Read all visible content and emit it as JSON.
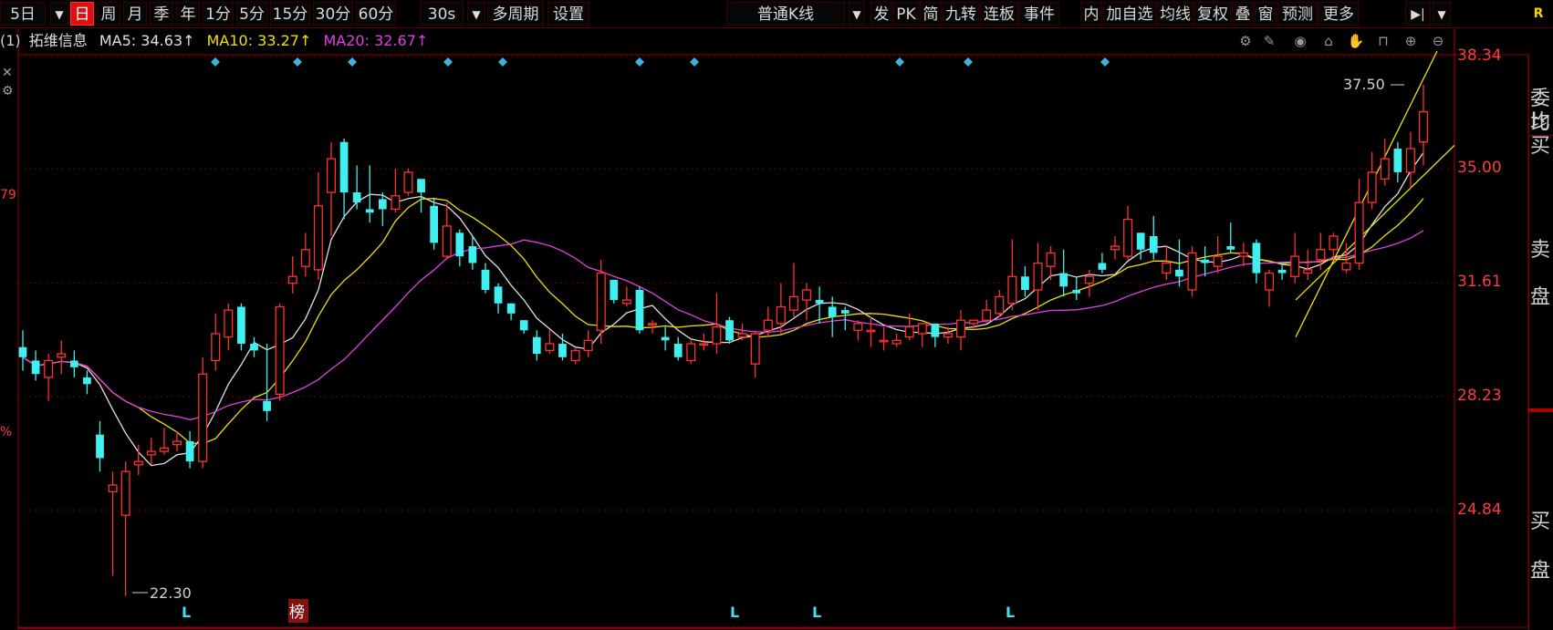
{
  "toolbar": {
    "period_dropdown": "5日",
    "periods": [
      "日",
      "周",
      "月",
      "季",
      "年",
      "1分",
      "5分",
      "15分",
      "30分",
      "60分"
    ],
    "active_period": "日",
    "interval_dropdown": "30s",
    "multi_period": "多周期",
    "settings": "设置",
    "chart_type": "普通K线",
    "right_buttons": [
      "发",
      "PK",
      "简",
      "九转",
      "连板",
      "事件",
      "内",
      "加自选",
      "均线",
      "复权",
      "叠",
      "窗",
      "预测",
      "更多"
    ],
    "r_badge": "R"
  },
  "info": {
    "prefix": "(1)",
    "name": "拓维信息",
    "ma5": "MA5: 34.63↑",
    "ma10": "MA10: 33.27↑",
    "ma20": "MA20: 32.67↑",
    "colors": {
      "name": "#e0e0e0",
      "ma5": "#e0e0e0",
      "ma10": "#f0e000",
      "ma20": "#e040e0"
    }
  },
  "price_axis": [
    "38.34",
    "35.00",
    "31.61",
    "28.23",
    "24.84"
  ],
  "annotations": {
    "high": "37.50",
    "low": "22.30"
  },
  "markers": {
    "L": "L",
    "bang": "榜"
  },
  "right_panel": [
    "委比",
    "均买",
    "卖",
    "盘",
    "买",
    "盘"
  ],
  "left_fragments": [
    "79",
    "%"
  ],
  "chart_data": {
    "type": "candlestick",
    "ylim": [
      21.5,
      39.5
    ],
    "up_color": "#ff3030",
    "down_color": "#40f0f0",
    "ma_colors": {
      "MA5": "#e0e0e0",
      "MA10": "#f0e000",
      "MA20": "#e040e0"
    },
    "candles": [
      [
        29.7,
        29.4,
        30.2,
        29.0
      ],
      [
        29.3,
        28.9,
        29.6,
        28.7
      ],
      [
        28.8,
        29.3,
        29.5,
        28.1
      ],
      [
        29.4,
        29.5,
        29.9,
        28.9
      ],
      [
        29.3,
        29.1,
        29.6,
        28.8
      ],
      [
        28.8,
        28.6,
        29.0,
        28.3
      ],
      [
        27.1,
        26.4,
        27.5,
        26.0
      ],
      [
        25.4,
        25.6,
        26.0,
        22.9
      ],
      [
        24.7,
        26.0,
        26.3,
        22.3
      ],
      [
        26.2,
        26.3,
        26.8,
        25.9
      ],
      [
        26.5,
        26.6,
        27.0,
        26.2
      ],
      [
        26.6,
        26.7,
        27.3,
        26.5
      ],
      [
        26.8,
        26.9,
        27.2,
        26.6
      ],
      [
        26.9,
        26.3,
        27.2,
        26.1
      ],
      [
        26.3,
        28.9,
        29.4,
        26.1
      ],
      [
        29.3,
        30.1,
        30.7,
        29.0
      ],
      [
        30.0,
        30.8,
        31.0,
        29.6
      ],
      [
        30.9,
        29.8,
        31.0,
        29.6
      ],
      [
        29.8,
        29.6,
        30.0,
        29.4
      ],
      [
        28.1,
        27.8,
        29.8,
        27.5
      ],
      [
        28.3,
        30.9,
        31.0,
        28.1
      ],
      [
        31.6,
        31.8,
        32.4,
        31.3
      ],
      [
        32.1,
        32.6,
        33.1,
        31.8
      ],
      [
        32.0,
        33.9,
        34.9,
        31.7
      ],
      [
        34.3,
        35.3,
        35.8,
        33.0
      ],
      [
        35.8,
        34.3,
        35.9,
        33.5
      ],
      [
        34.3,
        34.0,
        35.1,
        33.8
      ],
      [
        33.8,
        33.7,
        35.1,
        33.4
      ],
      [
        34.1,
        33.8,
        34.3,
        33.3
      ],
      [
        33.8,
        34.2,
        35.0,
        33.7
      ],
      [
        34.3,
        34.9,
        35.0,
        34.2
      ],
      [
        34.7,
        34.3,
        34.7,
        33.7
      ],
      [
        33.9,
        32.8,
        34.1,
        32.6
      ],
      [
        32.4,
        33.3,
        34.0,
        32.3
      ],
      [
        33.1,
        32.4,
        33.2,
        32.1
      ],
      [
        32.7,
        32.2,
        33.0,
        32.0
      ],
      [
        32.0,
        31.4,
        32.2,
        31.3
      ],
      [
        31.5,
        31.0,
        31.6,
        30.7
      ],
      [
        31.0,
        30.7,
        31.0,
        30.5
      ],
      [
        30.5,
        30.2,
        30.5,
        30.1
      ],
      [
        30.0,
        29.5,
        30.2,
        29.3
      ],
      [
        29.6,
        29.8,
        30.2,
        29.5
      ],
      [
        29.8,
        29.4,
        30.1,
        29.3
      ],
      [
        29.3,
        29.6,
        29.7,
        29.2
      ],
      [
        29.6,
        29.9,
        30.2,
        29.4
      ],
      [
        30.2,
        31.9,
        32.3,
        29.8
      ],
      [
        31.7,
        31.1,
        31.7,
        31.0
      ],
      [
        31.0,
        31.1,
        31.5,
        30.9
      ],
      [
        31.4,
        30.2,
        31.5,
        30.1
      ],
      [
        30.4,
        30.4,
        30.5,
        30.1
      ],
      [
        30.0,
        29.9,
        30.3,
        29.6
      ],
      [
        29.8,
        29.4,
        30.0,
        29.3
      ],
      [
        29.3,
        29.8,
        29.9,
        29.2
      ],
      [
        29.8,
        29.8,
        30.1,
        29.6
      ],
      [
        29.8,
        30.3,
        31.3,
        29.5
      ],
      [
        30.5,
        29.9,
        30.6,
        29.8
      ],
      [
        30.0,
        30.1,
        30.4,
        29.9
      ],
      [
        29.2,
        30.1,
        30.2,
        28.8
      ],
      [
        30.2,
        30.5,
        30.9,
        30.0
      ],
      [
        30.4,
        30.9,
        31.6,
        30.1
      ],
      [
        30.8,
        31.2,
        32.2,
        30.6
      ],
      [
        31.1,
        31.4,
        31.6,
        30.5
      ],
      [
        31.1,
        31.0,
        31.5,
        30.4
      ],
      [
        30.9,
        30.6,
        31.2,
        30.0
      ],
      [
        30.8,
        30.7,
        30.9,
        30.2
      ],
      [
        30.2,
        30.4,
        30.5,
        29.9
      ],
      [
        30.2,
        30.2,
        30.6,
        29.7
      ],
      [
        29.9,
        29.9,
        30.3,
        29.6
      ],
      [
        29.8,
        29.9,
        30.1,
        29.7
      ],
      [
        30.0,
        30.3,
        30.7,
        29.9
      ],
      [
        30.1,
        30.4,
        30.4,
        29.7
      ],
      [
        30.4,
        30.0,
        30.4,
        29.7
      ],
      [
        30.0,
        30.1,
        30.3,
        29.8
      ],
      [
        30.0,
        30.5,
        30.8,
        29.6
      ],
      [
        30.4,
        30.5,
        30.5,
        30.2
      ],
      [
        30.5,
        30.8,
        31.1,
        30.4
      ],
      [
        30.7,
        31.2,
        31.4,
        30.6
      ],
      [
        31.0,
        31.8,
        32.9,
        30.8
      ],
      [
        31.8,
        31.4,
        32.1,
        31.2
      ],
      [
        31.4,
        32.2,
        32.8,
        30.8
      ],
      [
        32.1,
        32.5,
        32.7,
        31.7
      ],
      [
        31.9,
        31.5,
        32.6,
        31.2
      ],
      [
        31.4,
        31.3,
        31.8,
        31.1
      ],
      [
        31.6,
        31.8,
        32.0,
        31.2
      ],
      [
        32.2,
        32.0,
        32.5,
        31.9
      ],
      [
        32.6,
        32.7,
        33.0,
        32.3
      ],
      [
        32.4,
        33.5,
        33.9,
        32.3
      ],
      [
        33.1,
        32.6,
        33.1,
        32.3
      ],
      [
        33.0,
        32.5,
        33.6,
        32.3
      ],
      [
        31.9,
        32.2,
        32.7,
        31.7
      ],
      [
        32.0,
        31.8,
        32.9,
        31.5
      ],
      [
        31.4,
        32.5,
        32.7,
        31.2
      ],
      [
        32.3,
        32.2,
        32.7,
        31.8
      ],
      [
        32.1,
        32.4,
        33.0,
        31.9
      ],
      [
        32.7,
        32.6,
        33.4,
        32.5
      ],
      [
        32.4,
        32.5,
        32.8,
        32.1
      ],
      [
        32.8,
        31.9,
        32.9,
        31.6
      ],
      [
        31.4,
        31.9,
        32.0,
        30.9
      ],
      [
        32.0,
        31.9,
        32.2,
        31.7
      ],
      [
        31.8,
        32.4,
        33.1,
        31.6
      ],
      [
        31.9,
        32.0,
        32.6,
        31.7
      ],
      [
        32.3,
        32.6,
        33.1,
        32.0
      ],
      [
        32.6,
        33.0,
        33.1,
        32.3
      ],
      [
        32.0,
        32.2,
        32.8,
        31.9
      ],
      [
        32.2,
        34.0,
        34.7,
        32.0
      ],
      [
        34.0,
        34.9,
        35.5,
        33.8
      ],
      [
        34.7,
        35.3,
        35.9,
        34.5
      ],
      [
        35.6,
        34.9,
        35.8,
        34.6
      ],
      [
        34.9,
        35.6,
        36.1,
        34.4
      ],
      [
        35.8,
        36.7,
        37.5,
        35.1
      ]
    ]
  }
}
